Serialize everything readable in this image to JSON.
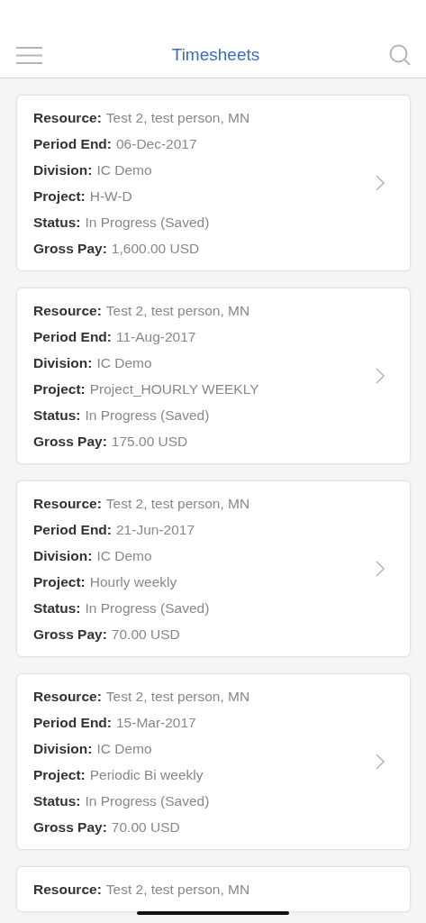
{
  "header": {
    "title": "Timesheets"
  },
  "timesheets": [
    {
      "fields": [
        {
          "label": "Resource:",
          "value": "Test 2, test person, MN"
        },
        {
          "label": "Period End:",
          "value": "06-Dec-2017"
        },
        {
          "label": "Division:",
          "value": "IC Demo"
        },
        {
          "label": "Project:",
          "value": "H-W-D"
        },
        {
          "label": "Status:",
          "value": "In Progress (Saved)"
        },
        {
          "label": "Gross Pay:",
          "value": "1,600.00 USD"
        }
      ]
    },
    {
      "fields": [
        {
          "label": "Resource:",
          "value": "Test 2, test person, MN"
        },
        {
          "label": "Period End:",
          "value": "11-Aug-2017"
        },
        {
          "label": "Division:",
          "value": "IC Demo"
        },
        {
          "label": "Project:",
          "value": "Project_HOURLY WEEKLY"
        },
        {
          "label": "Status:",
          "value": "In Progress (Saved)"
        },
        {
          "label": "Gross Pay:",
          "value": "175.00 USD"
        }
      ]
    },
    {
      "fields": [
        {
          "label": "Resource:",
          "value": "Test 2, test person, MN"
        },
        {
          "label": "Period End:",
          "value": "21-Jun-2017"
        },
        {
          "label": "Division:",
          "value": "IC Demo"
        },
        {
          "label": "Project:",
          "value": "Hourly weekly"
        },
        {
          "label": "Status:",
          "value": "In Progress (Saved)"
        },
        {
          "label": "Gross Pay:",
          "value": "70.00 USD"
        }
      ]
    },
    {
      "fields": [
        {
          "label": "Resource:",
          "value": "Test 2, test person, MN"
        },
        {
          "label": "Period End:",
          "value": "15-Mar-2017"
        },
        {
          "label": "Division:",
          "value": "IC Demo"
        },
        {
          "label": "Project:",
          "value": "Periodic Bi weekly"
        },
        {
          "label": "Status:",
          "value": "In Progress (Saved)"
        },
        {
          "label": "Gross Pay:",
          "value": "70.00 USD"
        }
      ]
    },
    {
      "fields": [
        {
          "label": "Resource:",
          "value": "Test 2, test person, MN"
        }
      ]
    }
  ]
}
